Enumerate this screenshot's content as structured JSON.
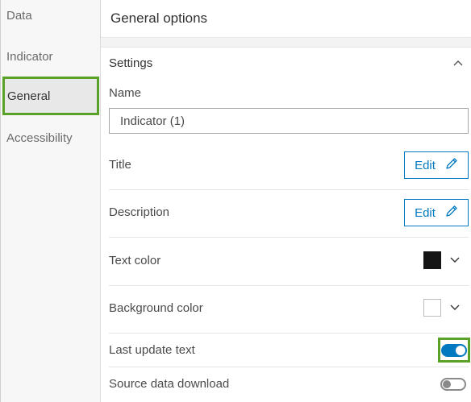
{
  "sidebar": {
    "items": [
      {
        "label": "Data",
        "icon": ""
      },
      {
        "label": "Indicator",
        "icon": ""
      },
      {
        "label": "General",
        "icon": ""
      },
      {
        "label": "Accessibility",
        "icon": ""
      }
    ],
    "active_index": 2
  },
  "header": {
    "title": "General options"
  },
  "settings": {
    "title": "Settings",
    "collapse_icon": "chevron-up-icon",
    "name": {
      "label": "Name",
      "value": "Indicator (1)"
    },
    "title_row": {
      "label": "Title",
      "button_label": "Edit",
      "icon": "pencil-icon"
    },
    "description_row": {
      "label": "Description",
      "button_label": "Edit",
      "icon": "pencil-icon"
    },
    "text_color": {
      "label": "Text color",
      "value": "#151515"
    },
    "background_color": {
      "label": "Background color",
      "value": "#ffffff"
    },
    "last_update_text": {
      "label": "Last update text",
      "enabled": true
    },
    "source_data_download": {
      "label": "Source data download",
      "enabled": false
    }
  },
  "colors": {
    "accent_blue": "#0079c1",
    "highlight_green": "#5aa127"
  }
}
